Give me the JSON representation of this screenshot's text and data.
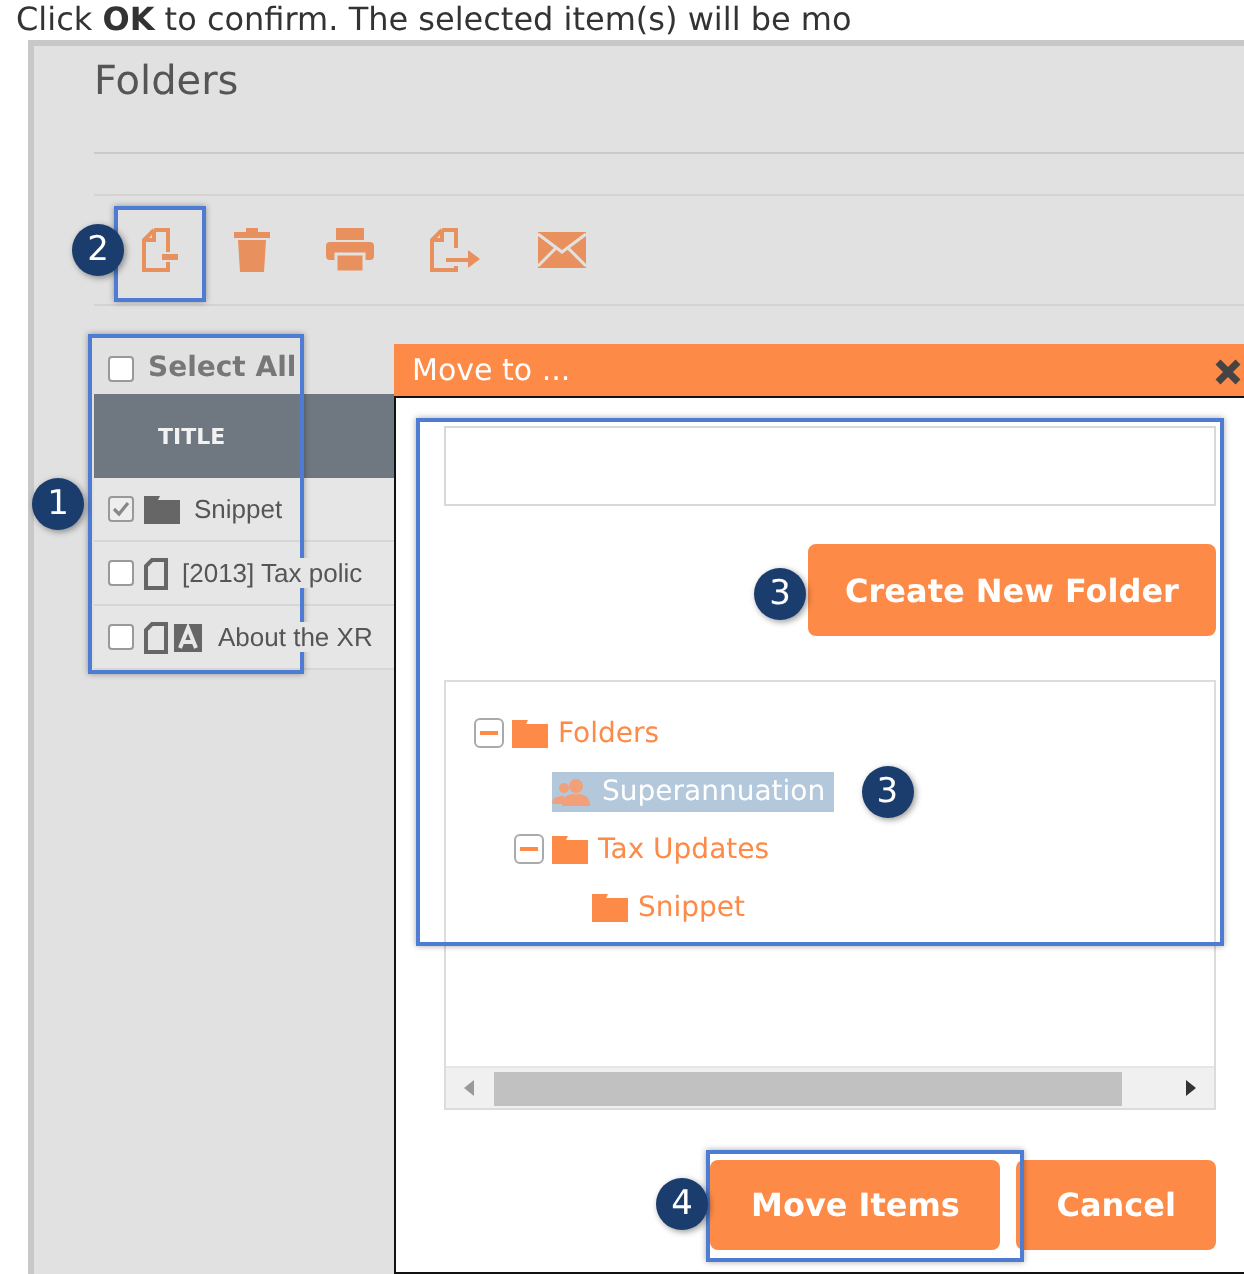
{
  "instruction": "Click **OK** to confirm. The selected item(s) will be mo",
  "panel": {
    "title": "Folders"
  },
  "toolbar": {
    "callout": "2"
  },
  "list": {
    "callout": "1",
    "select_all": {
      "label": "Select All",
      "checked": false
    },
    "columns": [
      "TITLE"
    ],
    "rows": [
      {
        "title": "Snippet",
        "kind": "folder",
        "checked": true
      },
      {
        "title": "[2013] Tax polic",
        "kind": "document",
        "checked": false
      },
      {
        "title": "About the XR",
        "kind": "document-article",
        "checked": false
      }
    ]
  },
  "dialog": {
    "title": "Move to ...",
    "form_callout": "3",
    "create_button": "Create New Folder",
    "tree": [
      {
        "label": "Folders",
        "kind": "folder",
        "expanded": true,
        "selected": false,
        "children": [
          {
            "label": "Superannuation",
            "kind": "shared",
            "selected": true,
            "callout": "3"
          },
          {
            "label": "Tax Updates",
            "kind": "folder",
            "expanded": true,
            "selected": false,
            "children": [
              {
                "label": "Snippet",
                "kind": "folder",
                "selected": false
              }
            ]
          }
        ]
      }
    ],
    "buttons": [
      {
        "label": "Move Items",
        "callout": "4"
      },
      {
        "label": "Cancel"
      }
    ]
  }
}
